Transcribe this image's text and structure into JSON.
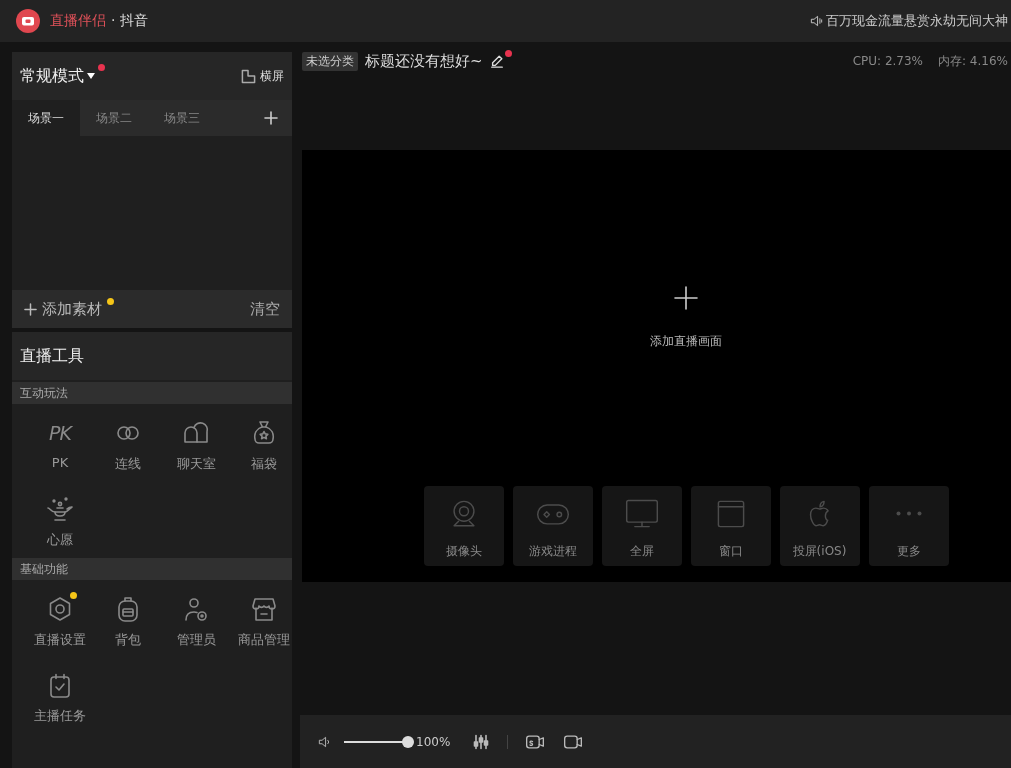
{
  "title_bar": {
    "app_name": "直播伴侣",
    "platform": "· 抖音",
    "notice": "百万现金流量悬赏永劫无间大神"
  },
  "scene_panel": {
    "mode": {
      "label": "常规模式",
      "dot": true
    },
    "orientation": "横屏",
    "tabs": [
      {
        "label": "场景一",
        "selected": true
      },
      {
        "label": "场景二",
        "selected": false
      },
      {
        "label": "场景三",
        "selected": false
      }
    ],
    "add_source": {
      "label": "添加素材",
      "dot": true
    },
    "clear": "清空"
  },
  "tools": {
    "title": "直播工具",
    "sections": [
      {
        "title": "互动玩法",
        "items": [
          {
            "label": "PK",
            "glyph": "PK",
            "dot": false
          },
          {
            "label": "连线",
            "dot": false
          },
          {
            "label": "聊天室",
            "dot": false
          },
          {
            "label": "福袋",
            "dot": false
          },
          {
            "label": "心愿",
            "dot": false
          }
        ]
      },
      {
        "title": "基础功能",
        "items": [
          {
            "label": "直播设置",
            "dot": true
          },
          {
            "label": "背包",
            "dot": false
          },
          {
            "label": "管理员",
            "dot": false
          },
          {
            "label": "商品管理",
            "dot": false
          },
          {
            "label": "主播任务",
            "dot": false
          }
        ]
      }
    ]
  },
  "stream_info": {
    "category": "未选分类",
    "title": "标题还没有想好~",
    "dot": true,
    "cpu": "CPU: 2.73%",
    "memory": "内存: 4.16%"
  },
  "preview": {
    "hint": "添加直播画面",
    "sources": [
      {
        "label": "摄像头"
      },
      {
        "label": "游戏进程"
      },
      {
        "label": "全屏"
      },
      {
        "label": "窗口"
      },
      {
        "label": "投屏(iOS)"
      },
      {
        "label": "更多"
      }
    ]
  },
  "bottom_bar": {
    "volume": {
      "level": 1,
      "reading": "100%"
    }
  }
}
